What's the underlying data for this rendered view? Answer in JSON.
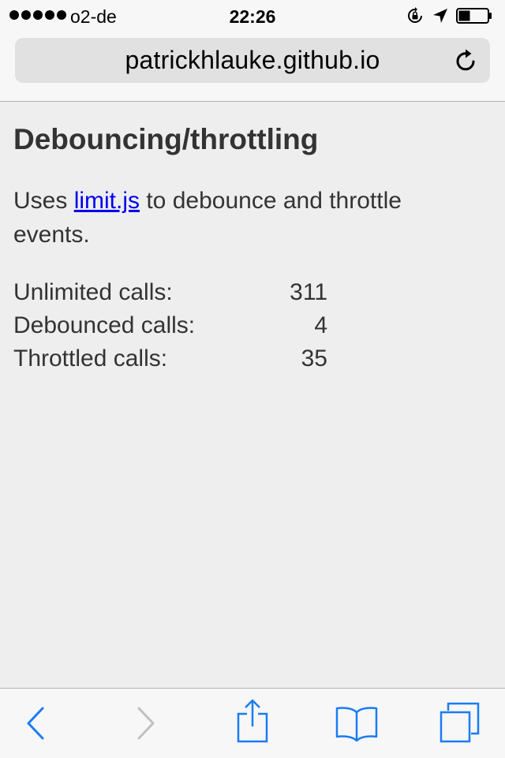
{
  "status_bar": {
    "carrier": "o2-de",
    "time": "22:26",
    "signal_bars": 5,
    "battery_level": 0.4,
    "icons": [
      "signal-dots-icon",
      "rotation-lock-icon",
      "location-arrow-icon",
      "battery-icon"
    ]
  },
  "address_bar": {
    "url": "patrickhlauke.github.io",
    "reload_icon": "reload-icon"
  },
  "page": {
    "title": "Debouncing/throttling",
    "intro_prefix": "Uses ",
    "intro_link": "limit.js",
    "intro_suffix": " to debounce and throttle events.",
    "stats": [
      {
        "label": "Unlimited calls:",
        "value": "311"
      },
      {
        "label": "Debounced calls:",
        "value": "4"
      },
      {
        "label": "Throttled calls:",
        "value": "35"
      }
    ]
  },
  "toolbar": {
    "icons": [
      "back-icon",
      "forward-icon",
      "share-icon",
      "bookmarks-icon",
      "tabs-icon"
    ],
    "accent_color": "#1a7cf4",
    "disabled_color": "#c0c0c0"
  }
}
